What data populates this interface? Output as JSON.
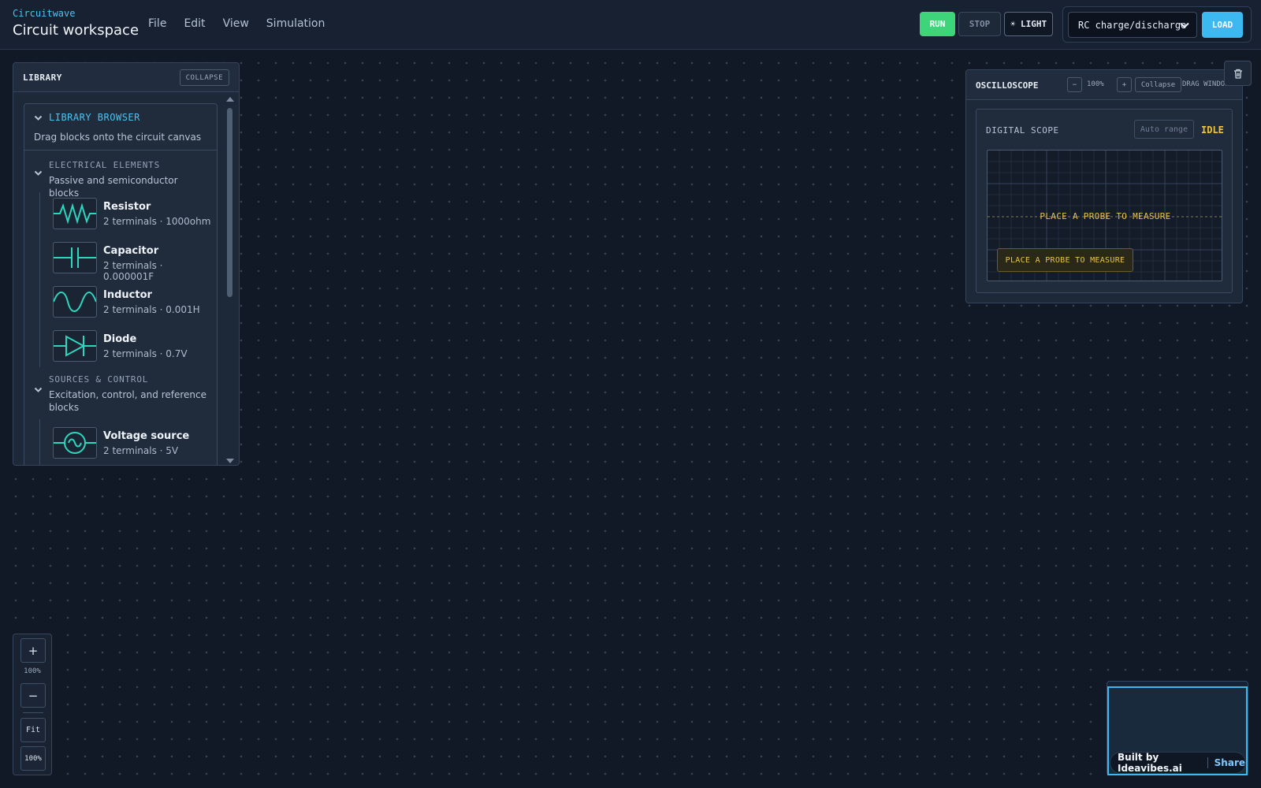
{
  "app": {
    "name": "Circuitwave",
    "title": "Circuit workspace"
  },
  "menu": [
    "File",
    "Edit",
    "View",
    "Simulation"
  ],
  "toolbar": {
    "run": "RUN",
    "stop": "STOP",
    "light": "☀ LIGHT",
    "preset": "RC charge/discharge",
    "load": "LOAD"
  },
  "library": {
    "title": "LIBRARY",
    "collapse": "COLLAPSE",
    "browser_title": "LIBRARY BROWSER",
    "browser_sub": "Drag blocks onto the circuit canvas",
    "categories": [
      {
        "title": "ELECTRICAL ELEMENTS",
        "subtitle": "Passive and semiconductor blocks",
        "items": [
          {
            "name": "Resistor",
            "detail": "2 terminals · 1000ohm",
            "icon": "resistor-icon"
          },
          {
            "name": "Capacitor",
            "detail": "2 terminals · 0.000001F",
            "icon": "capacitor-icon"
          },
          {
            "name": "Inductor",
            "detail": "2 terminals · 0.001H",
            "icon": "inductor-icon"
          },
          {
            "name": "Diode",
            "detail": "2 terminals · 0.7V",
            "icon": "diode-icon"
          }
        ]
      },
      {
        "title": "SOURCES & CONTROL",
        "subtitle": "Excitation, control, and reference blocks",
        "items": [
          {
            "name": "Voltage source",
            "detail": "2 terminals · 5V",
            "icon": "voltage-source-icon"
          }
        ]
      }
    ]
  },
  "scope": {
    "title": "OSCILLOSCOPE",
    "zoom_out": "−",
    "zoom": "100%",
    "zoom_in": "+",
    "collapse": "Collapse",
    "drag": "DRAG WINDOW",
    "label": "DIGITAL SCOPE",
    "auto_range": "Auto range",
    "status": "IDLE",
    "screen_msg": "PLACE A PROBE TO MEASURE",
    "probe_msg": "PLACE A PROBE TO MEASURE"
  },
  "zoom": {
    "in": "+",
    "level": "100%",
    "out": "−",
    "fit": "Fit",
    "reset": "100%"
  },
  "footer": {
    "built": "Built by Ideavibes.ai",
    "share": "Share"
  },
  "colors": {
    "accent": "#3cb9f0",
    "run": "#3dd47a",
    "warning": "#f0c53c",
    "icon_stroke": "#2fd6bf"
  }
}
